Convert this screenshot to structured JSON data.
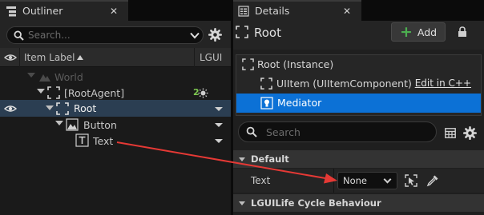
{
  "outliner": {
    "tab_title": "Outliner",
    "search_placeholder": "Search...",
    "columns": {
      "item_label": "Item Label",
      "lgui": "LGUI"
    },
    "rows": [
      {
        "label": "World"
      },
      {
        "label": "[RootAgent]",
        "badge": "2"
      },
      {
        "label": "Root"
      },
      {
        "label": "Button"
      },
      {
        "label": "Text"
      }
    ]
  },
  "details": {
    "tab_title": "Details",
    "title": "Root",
    "add_label": "Add",
    "components": [
      {
        "label": "Root (Instance)"
      },
      {
        "label": "UIItem (UIItemComponent)",
        "link": "Edit in C++"
      },
      {
        "label": "Mediator"
      }
    ],
    "search_placeholder": "Search",
    "categories": [
      {
        "label": "Default"
      },
      {
        "label": "LGUILife Cycle Behaviour"
      }
    ],
    "property": {
      "name": "Text",
      "value": "None"
    }
  },
  "colors": {
    "selection": "#0c71d6",
    "tree_selection": "#2b3e52",
    "annotation_arrow": "#e53935",
    "add_plus": "#4caf50",
    "badge": "#7ec850"
  },
  "icons": [
    "eye-icon",
    "search-icon",
    "gear-icon",
    "lock-icon",
    "plus-icon",
    "dropdown-chevron-icon",
    "world-icon",
    "ui-item-icon",
    "button-icon",
    "text-icon",
    "sun-icon",
    "table-view-icon",
    "browse-icon",
    "eyedropper-icon",
    "annotation-arrow"
  ]
}
